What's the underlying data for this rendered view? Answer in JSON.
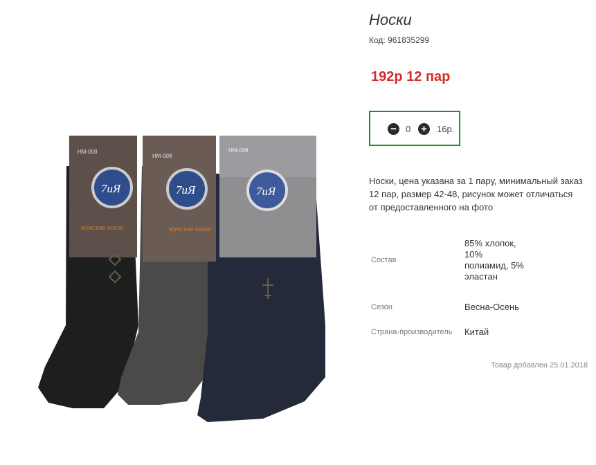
{
  "product": {
    "title": "Носки",
    "code": "Код: 961835299",
    "price": "192р 12 пар",
    "quantity": {
      "value": "0",
      "unit": "16р."
    },
    "description": "Носки, цена указана за 1 пару, минимальный заказ 12 пар, размер 42-48, рисунок может отличаться от предоставленного на фото",
    "specs": [
      {
        "key": "Состав",
        "value": "85% хлопок, 10% полиамид, 5% эластан"
      },
      {
        "key": "Сезон",
        "value": "Весна-Осень"
      },
      {
        "key": "Страна-производитель",
        "value": "Китай"
      }
    ],
    "added": "Товар добавлен 25.01.2018"
  },
  "image": {
    "card_code": "HM-008",
    "logo_text": "7иЯ",
    "card_caption": "мужские носки",
    "icon": "sock-product-photo"
  },
  "colors": {
    "price": "#d52b2b",
    "qty_border": "#2b8a2b"
  }
}
